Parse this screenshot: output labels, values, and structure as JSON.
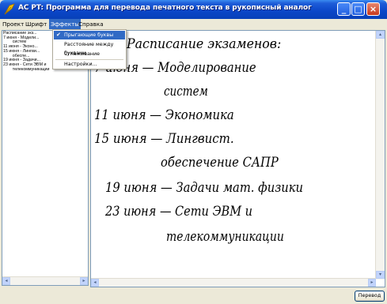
{
  "window": {
    "title": "AC PT: Программа для перевода печатного текста в рукописный аналог",
    "icon": "feather-pen-icon",
    "controls": [
      "minimize-icon",
      "maximize-icon",
      "close-icon"
    ]
  },
  "menu": {
    "items": [
      "Проект",
      "Шрифт",
      "Эффекты",
      "Справка"
    ],
    "active": "Эффекты",
    "dropdown": {
      "checked_label": "Прыгающие буквы",
      "item2_label": "Расстояние между буквами",
      "item3_label": "Сглаживание",
      "item4_label": "Настройки..."
    }
  },
  "editor": {
    "text": "Расписание экз...\n7 июня - Модели...\n        систем\n11 июня - Эконо...\n15 июня - Лингви...\n        обеспе...\n19 июня - Задачи...\n23 июня - Сети ЭВМ и\n        телекоммуникации"
  },
  "canvas": {
    "handwritten_lines": [
      "Расписание экзаменов:",
      "7 июня — Моделирование",
      "систем",
      "11 июня — Экономика",
      "15 июня — Лингвист.",
      "обеспечение САПР",
      "19 июня — Задачи мат. физики",
      "23 июня — Сети ЭВМ и",
      "телекоммуникации"
    ],
    "ink_color": "#000000"
  },
  "colors": {
    "titlebar": "#0a46c8",
    "menu_highlight": "#316ac5",
    "window_bg": "#ece9d8"
  },
  "buttons": {
    "translate_label": "Перевод"
  }
}
